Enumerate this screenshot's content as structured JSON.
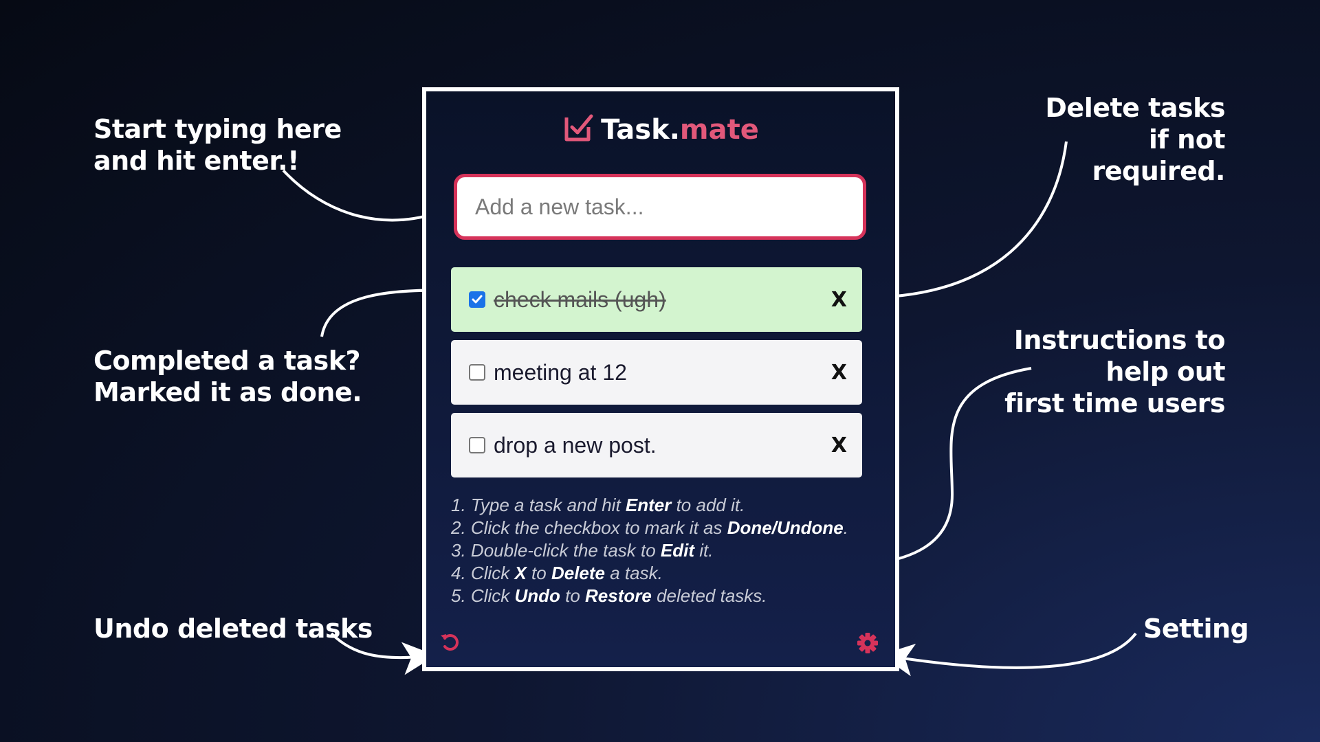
{
  "annotations": {
    "start_typing": [
      "Start typing here",
      "and hit enter.!"
    ],
    "completed": [
      "Completed a task?",
      "Marked it as done."
    ],
    "undo": [
      "Undo deleted tasks"
    ],
    "delete": [
      "Delete tasks",
      "if not",
      "required."
    ],
    "instructions": [
      "Instructions to",
      "help out",
      "first time users"
    ],
    "setting": [
      "Setting"
    ]
  },
  "app": {
    "brand_main": "Task.",
    "brand_accent": "mate",
    "input_placeholder": "Add a new task...",
    "tasks": [
      {
        "text": "check mails (ugh)",
        "done": true
      },
      {
        "text": "meeting at 12",
        "done": false
      },
      {
        "text": "drop a new post.",
        "done": false
      }
    ],
    "delete_label": "X",
    "instructions": [
      {
        "num": "1.",
        "p1": " Type a task and hit ",
        "b1": "Enter",
        "p2": " to add it.",
        "b2": "",
        "p3": ""
      },
      {
        "num": "2.",
        "p1": " Click the checkbox to mark it as ",
        "b1": "Done/Undone",
        "p2": ".",
        "b2": "",
        "p3": ""
      },
      {
        "num": "3.",
        "p1": " Double-click the task to ",
        "b1": "Edit",
        "p2": " it.",
        "b2": "",
        "p3": ""
      },
      {
        "num": "4.",
        "p1": " Click ",
        "b1": "X",
        "p2": " to ",
        "b2": "Delete",
        "p3": " a task."
      },
      {
        "num": "5.",
        "p1": " Click ",
        "b1": "Undo",
        "p2": " to ",
        "b2": "Restore",
        "p3": " deleted tasks."
      }
    ]
  },
  "colors": {
    "accent": "#d6335a",
    "done_row": "#d3f4cf",
    "frame_border": "#ffffff"
  },
  "icons": {
    "logo": "checkbox-logo-icon",
    "checked": "checkmark-icon",
    "undo": "undo-icon",
    "settings": "gear-icon"
  }
}
